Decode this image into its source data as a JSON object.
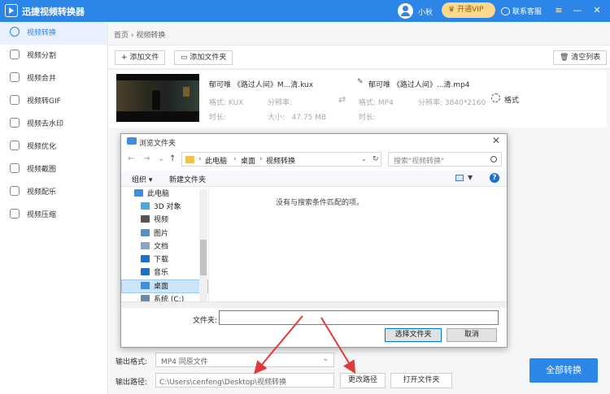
{
  "app": {
    "title": "迅捷视频转换器",
    "username": "小秋",
    "vip_label": "开通VIP",
    "support_label": "联系客服",
    "accent": "#2b86e8"
  },
  "sidebar": {
    "items": [
      {
        "label": "视频转换",
        "icon": "video-convert-icon",
        "active": true
      },
      {
        "label": "视频分割",
        "icon": "video-split-icon"
      },
      {
        "label": "视频合并",
        "icon": "video-merge-icon"
      },
      {
        "label": "视频转GIF",
        "icon": "gif-icon"
      },
      {
        "label": "视频去水印",
        "icon": "watermark-icon"
      },
      {
        "label": "视频优化",
        "icon": "optimize-icon"
      },
      {
        "label": "视频截图",
        "icon": "screenshot-icon"
      },
      {
        "label": "视频配乐",
        "icon": "music-icon"
      },
      {
        "label": "视频压缩",
        "icon": "compress-icon"
      }
    ]
  },
  "breadcrumb": {
    "home": "首页",
    "sep": "›",
    "current": "视频转换"
  },
  "toolbar": {
    "add_file": "+ 添加文件",
    "add_folder": "添加文件夹",
    "clear_list": "清空列表"
  },
  "file": {
    "source_name": "郁可唯 《路过人间》M...清.kux",
    "target_name": "郁可唯 《路过人间》...清.mp4",
    "format_label": "格式:",
    "source_format": "KUX",
    "target_format": "MP4",
    "resolution_label": "分辨率:",
    "target_resolution": "3840*2160",
    "duration_label": "时长:",
    "size_label": "大小:",
    "size_value": "47.75 MB",
    "settings_label": "格式"
  },
  "dialog": {
    "title": "浏览文件夹",
    "address": [
      "此电脑",
      "桌面",
      "视频转换"
    ],
    "search_placeholder": "搜索\"视频转换\"",
    "organize": "组织 ▾",
    "new_folder": "新建文件夹",
    "tree": [
      {
        "label": "此电脑",
        "color": "#3a8ee6"
      },
      {
        "label": "3D 对象",
        "color": "#4aa7e8"
      },
      {
        "label": "视频",
        "color": "#555555"
      },
      {
        "label": "图片",
        "color": "#5b8fc4"
      },
      {
        "label": "文档",
        "color": "#8aa4c4"
      },
      {
        "label": "下载",
        "color": "#1f6fc6"
      },
      {
        "label": "音乐",
        "color": "#1f6fc6"
      },
      {
        "label": "桌面",
        "color": "#3a8ee6",
        "selected": true
      },
      {
        "label": "系统 (C:)",
        "color": "#6c8aa8"
      }
    ],
    "empty_message": "没有与搜索条件匹配的项。",
    "folder_label": "文件夹:",
    "folder_value": "",
    "select_button": "选择文件夹",
    "cancel_button": "取消"
  },
  "output": {
    "format_label": "输出格式:",
    "format_value": "MP4  同原文件",
    "path_label": "输出路径:",
    "path_value": "C:\\Users\\cenfeng\\Desktop\\视频转换",
    "change_path": "更改路径",
    "open_folder": "打开文件夹",
    "convert_all": "全部转换"
  }
}
